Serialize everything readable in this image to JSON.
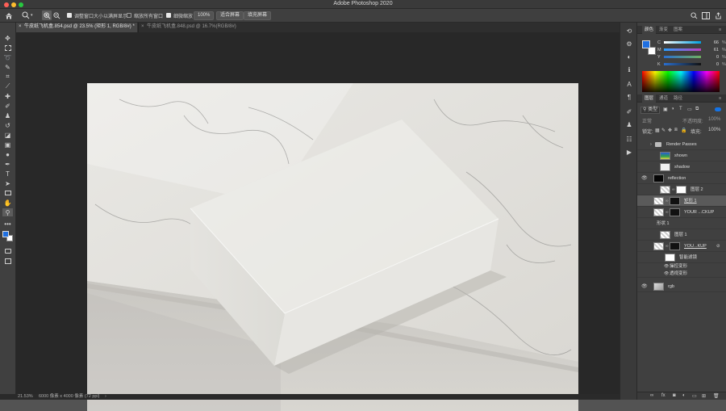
{
  "window": {
    "title": "Adobe Photoshop 2020"
  },
  "options": {
    "fit_window_label": "调整窗口大小以满屏显示",
    "zoom_all_label": "缩放所有窗口",
    "scrubby_label": "细微缩放",
    "zoom_value": "100%",
    "fit_screen_label": "适合屏幕",
    "fill_screen_label": "填充屏幕"
  },
  "doc_tabs": [
    {
      "label": "牛皮纸飞机盒.854.psd @ 23.5% (矩形 1, RGB/8#) *"
    },
    {
      "label": "牛皮纸飞机盒.848.psd @ 16.7%(RGB/8#)"
    }
  ],
  "status": {
    "zoom": "21.53%",
    "doc_size": "6000 像素 x 4000 像素 (72 ppi)"
  },
  "colors": {
    "foreground": "#1f6fe0",
    "background": "#ffffff",
    "accent": "#1473e6"
  },
  "color_panel": {
    "tabs": [
      "颜色",
      "渐变",
      "图案"
    ],
    "sliders": [
      {
        "label": "C",
        "value": "66",
        "unit": "%"
      },
      {
        "label": "M",
        "value": "61",
        "unit": "%"
      },
      {
        "label": "Y",
        "value": "0",
        "unit": "%"
      },
      {
        "label": "K",
        "value": "0",
        "unit": "%"
      }
    ]
  },
  "layers_panel": {
    "tabs": [
      "图层",
      "通道",
      "路径"
    ],
    "filter_kind": "类型",
    "blend_mode": "正常",
    "opacity_label": "不透明度:",
    "opacity": "100%",
    "lock_label": "锁定:",
    "fill_label": "填充:",
    "fill": "100%",
    "layers": [
      {
        "name": "Render Passes",
        "type": "group"
      },
      {
        "name": "shown",
        "type": "layer"
      },
      {
        "name": "shadow",
        "type": "layer"
      },
      {
        "name": "reflection",
        "type": "layer"
      },
      {
        "name": "图层 2",
        "type": "layer"
      },
      {
        "name": "矩形 1",
        "type": "smart"
      },
      {
        "name": "YOUR ...CKUP",
        "type": "smart"
      },
      {
        "name": "形状 1",
        "type": "shape"
      },
      {
        "name": "图层 1",
        "type": "layer"
      },
      {
        "name": "YOU...KUP",
        "type": "smart"
      },
      {
        "name": "智能滤镜",
        "type": "filter"
      },
      {
        "name": "操控变形",
        "type": "filter-item"
      },
      {
        "name": "透视变形",
        "type": "filter-item"
      },
      {
        "name": "rgb",
        "type": "layer"
      }
    ]
  },
  "icons": {
    "home": "home-icon",
    "zoom": "zoom-icon",
    "zoom_in": "zoom-in-icon",
    "zoom_out": "zoom-out-icon"
  }
}
